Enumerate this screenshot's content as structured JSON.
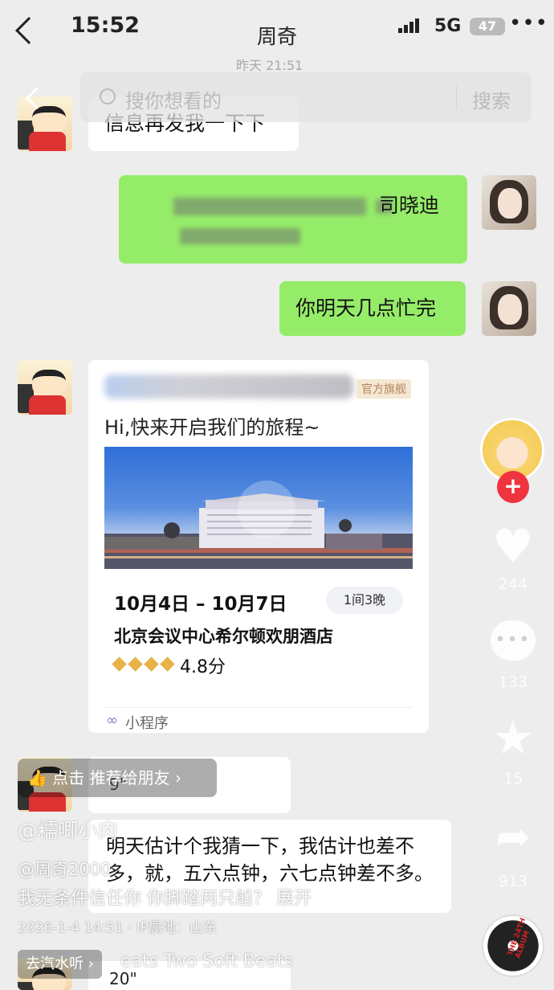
{
  "status_bar": {
    "time": "15:52",
    "network": "5G",
    "battery": "47",
    "more": "•••"
  },
  "chat": {
    "title": "周奇",
    "timestamp_peek": "昨天 21:51"
  },
  "search": {
    "placeholder": "搜你想看的",
    "button": "搜索"
  },
  "messages": {
    "m1": "信息再发我一下下",
    "m2_visible": "司晓迪",
    "m3": "你明天几点忙完",
    "long_voice_text": "明天估计个我猜一下，我估计也差不多，就，五六点钟，六七点钟差不多。",
    "voice1_duration": "9\"",
    "voice2_duration": "20\""
  },
  "card": {
    "official_tag": "官方旗舰",
    "greeting": "Hi,快来开启我们的旅程~",
    "dates": "10月4日 – 10月7日",
    "room_badge": "1间3晚",
    "hotel_name": "北京会议中心希尔顿欢朋酒店",
    "rating": "4.8分",
    "rating_diamonds": 4,
    "mini_program": "小程序"
  },
  "feed": {
    "likes": "244",
    "comments": "133",
    "favorites": "15",
    "shares": "913",
    "recommend": "点击 推荐给朋友",
    "author": "@糯唧小肉",
    "tag": "@周奇2000",
    "description": "我无条件信任你 你脚踏两只船？  展开",
    "meta": "2026-1-4 14:51 · IP属地：山东",
    "music_pill": "去汽水听 ›",
    "music": "eats  Two Soft Beats",
    "album": "THE 24TH ALBUM"
  },
  "colors": {
    "accent_green": "#95ec69",
    "plus_red": "#f0343f"
  }
}
